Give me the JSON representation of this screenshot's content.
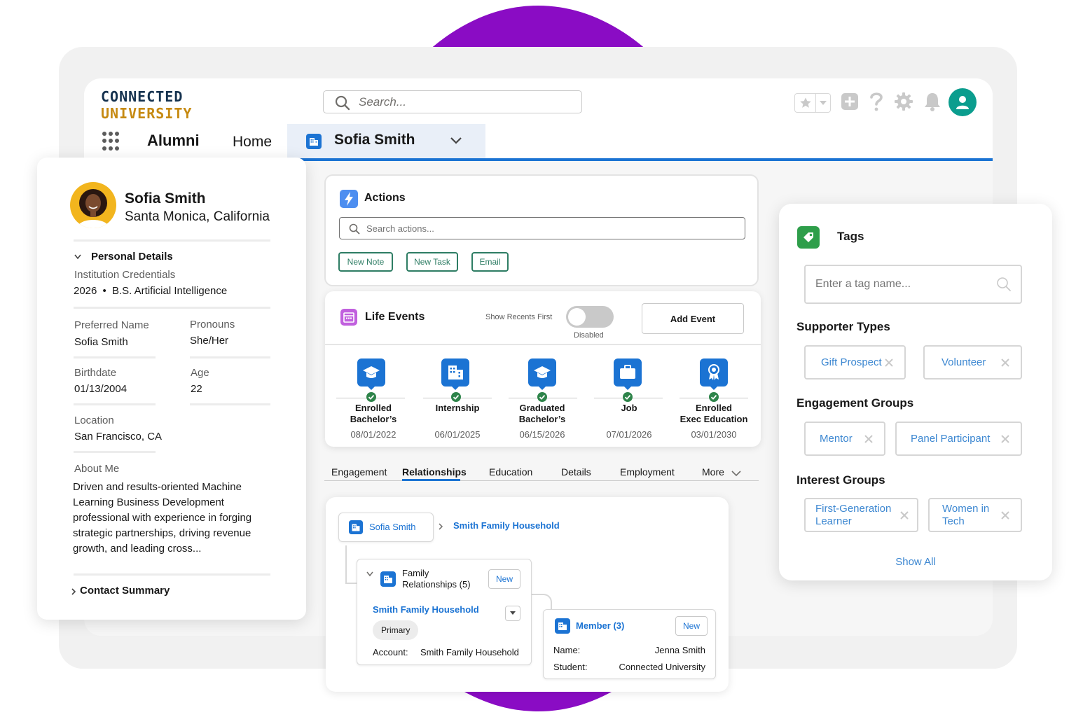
{
  "brand": {
    "line1": "CONNECTED",
    "line2": "UNIVERSITY"
  },
  "search": {
    "placeholder": "Search..."
  },
  "nav": {
    "app_name": "Alumni",
    "home": "Home",
    "active_tab": "Sofia Smith"
  },
  "profile": {
    "name": "Sofia Smith",
    "location": "Santa Monica, California",
    "personal_details_title": "Personal Details",
    "institution_credentials_label": "Institution Credentials",
    "credential_year": "2026",
    "credential_dot": "•",
    "credential_degree": "B.S. Artificial Intelligence",
    "preferred_name_label": "Preferred Name",
    "preferred_name": "Sofia Smith",
    "pronouns_label": "Pronouns",
    "pronouns": "She/Her",
    "birthdate_label": "Birthdate",
    "birthdate": "01/13/2004",
    "age_label": "Age",
    "age": "22",
    "location_label": "Location",
    "location_value": "San Francisco, CA",
    "about_label": "About Me",
    "about_lines": [
      "Driven and results-oriented Machine",
      "Learning Business Development",
      "professional with experience in forging",
      "strategic partnerships, driving revenue",
      "growth, and leading cross..."
    ],
    "contact_summary": "Contact Summary"
  },
  "actions": {
    "title": "Actions",
    "search_placeholder": "Search actions...",
    "buttons": [
      "New Note",
      "New Task",
      "Email"
    ]
  },
  "life_events": {
    "title": "Life Events",
    "toggle_label": "Show Recents First",
    "toggle_state": "Disabled",
    "add_button": "Add Event",
    "events": [
      {
        "line1": "Enrolled",
        "line2": "Bachelor’s",
        "date": "08/01/2022",
        "icon": "graduation-cap-icon"
      },
      {
        "line1": "Internship",
        "line2": "",
        "date": "06/01/2025",
        "icon": "building-icon"
      },
      {
        "line1": "Graduated",
        "line2": "Bachelor’s",
        "date": "06/15/2026",
        "icon": "graduation-cap-icon"
      },
      {
        "line1": "Job",
        "line2": "",
        "date": "07/01/2026",
        "icon": "briefcase-icon"
      },
      {
        "line1": "Enrolled",
        "line2": "Exec Education",
        "date": "03/01/2030",
        "icon": "award-icon"
      }
    ]
  },
  "record_tabs": {
    "items": [
      "Engagement",
      "Relationships",
      "Education",
      "Details",
      "Employment",
      "More"
    ],
    "active": "Relationships"
  },
  "relationships": {
    "root": "Sofia Smith",
    "household_link": "Smith Family Household",
    "family_title_line1": "Family",
    "family_title_line2": "Relationships (5)",
    "new_button": "New",
    "household_name": "Smith Family Household",
    "primary_badge": "Primary",
    "account_label": "Account:",
    "account_value": "Smith Family Household",
    "member_title": "Member (3)",
    "member_new_button": "New",
    "name_label": "Name:",
    "name_value": "Jenna Smith",
    "student_label": "Student:",
    "student_value": "Connected University"
  },
  "tags": {
    "title": "Tags",
    "input_placeholder": "Enter a tag name...",
    "supporter_types_title": "Supporter Types",
    "supporter_types": [
      "Gift Prospect",
      "Volunteer"
    ],
    "engagement_groups_title": "Engagement Groups",
    "engagement_groups": [
      "Mentor",
      "Panel Participant"
    ],
    "interest_groups_title": "Interest Groups",
    "interest_groups": [
      {
        "line1": "First-Generation",
        "line2": "Learner"
      },
      {
        "line1": "Women in",
        "line2": "Tech"
      }
    ],
    "show_all": "Show All"
  },
  "colors": {
    "brand_navy": "#15324f",
    "brand_gold": "#c68a12",
    "accent_blue": "#1b73d3",
    "action_green": "#2e7d64",
    "success_green": "#2e844a",
    "purple": "#8a0cc4"
  }
}
